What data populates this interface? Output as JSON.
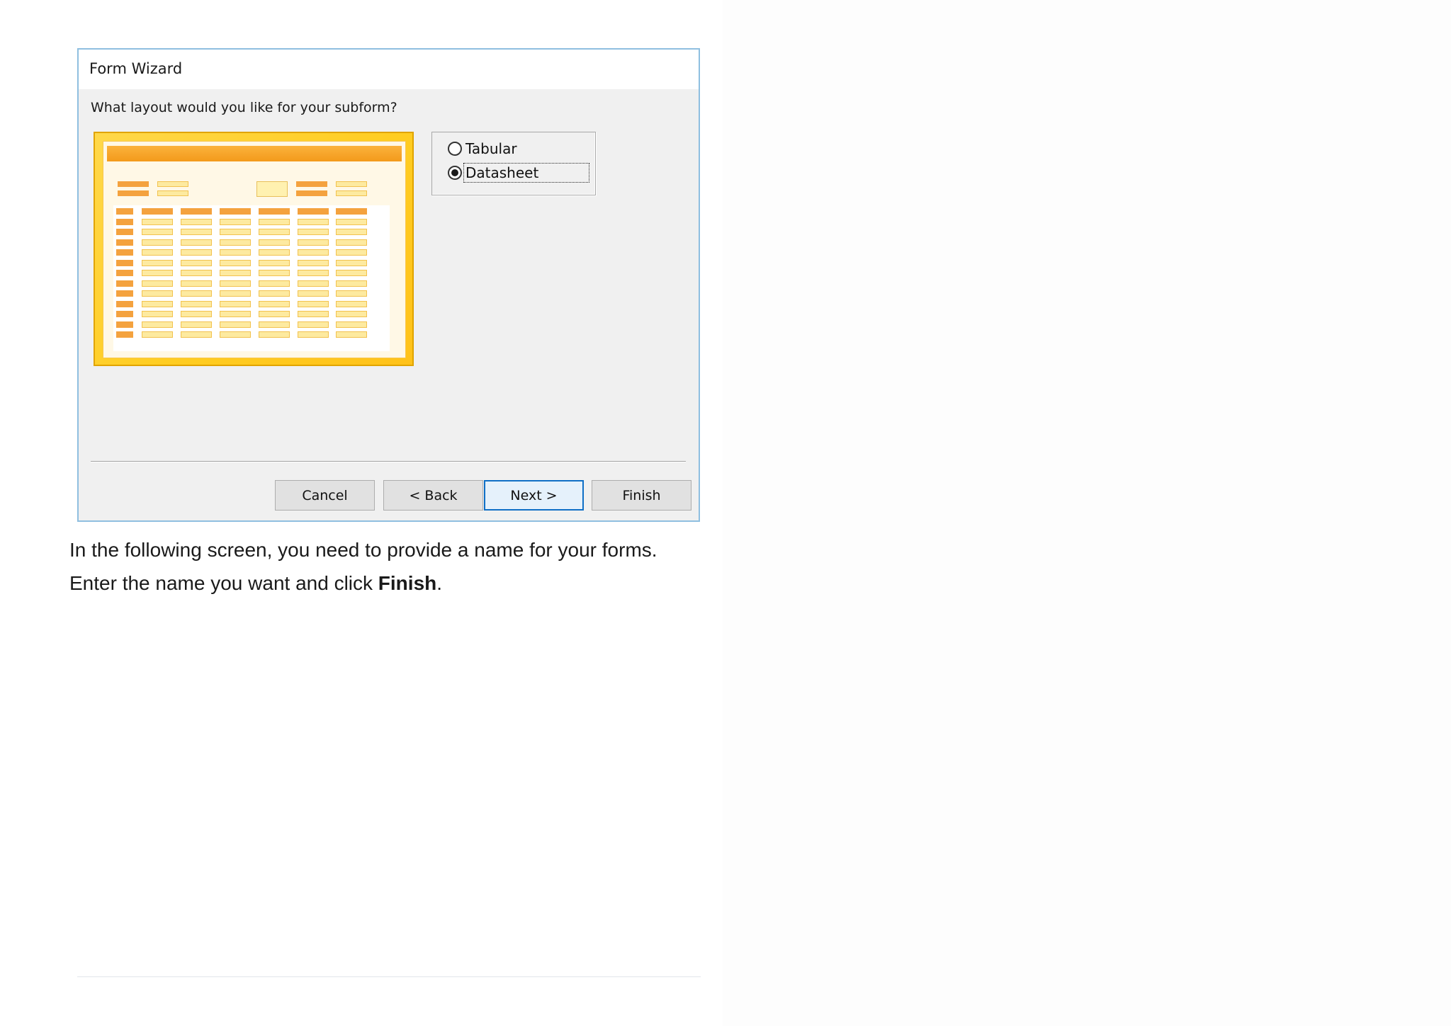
{
  "dialog": {
    "title": "Form Wizard",
    "question": "What layout would you like for your subform?",
    "options": [
      {
        "label": "Tabular",
        "selected": false
      },
      {
        "label": "Datasheet",
        "selected": true
      }
    ],
    "buttons": {
      "cancel": "Cancel",
      "back": "< Back",
      "next": "Next >",
      "finish": "Finish"
    },
    "default_button": "next",
    "colors": {
      "border": "#8fbfe0",
      "default_button_border": "#0f6fc6",
      "preview_frame": "#ffcd22",
      "preview_header": "#f39a1b"
    }
  },
  "body_text": {
    "line1": "In the following screen, you need to provide a name for your forms.",
    "line2_prefix": "Enter the name you want and click ",
    "line2_bold": "Finish",
    "line2_suffix": "."
  }
}
